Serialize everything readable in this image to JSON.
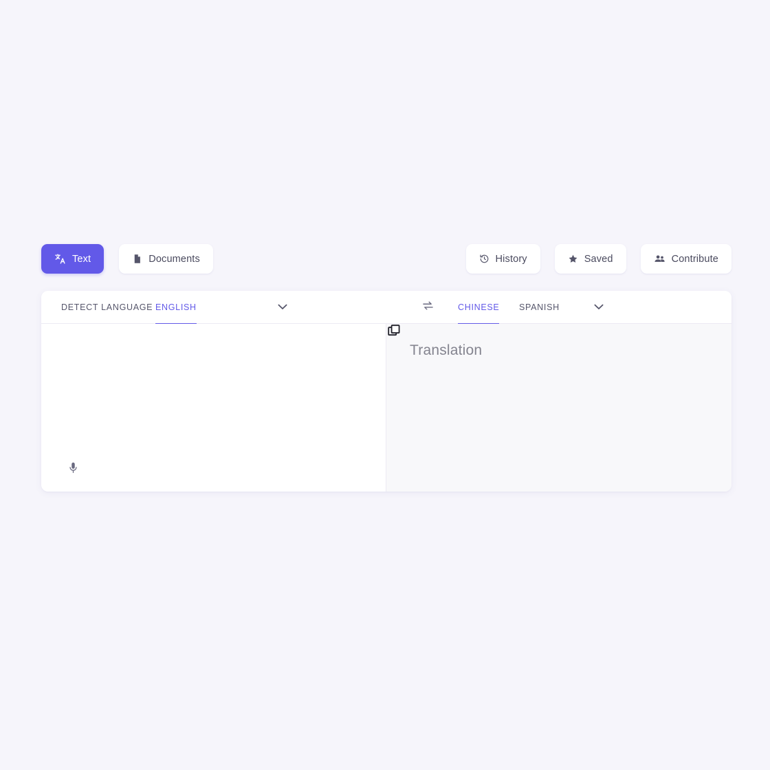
{
  "theme": {
    "accent": "#6259e8",
    "page_bg": "#f6f5fb",
    "card_bg": "#ffffff",
    "output_bg": "#f8f8fa",
    "text_muted": "#84848f"
  },
  "toolbar": {
    "left_items": [
      {
        "label": "Text",
        "icon": "translate-icon",
        "active": true
      },
      {
        "label": "Documents",
        "icon": "document-icon",
        "active": false
      }
    ],
    "right_items": [
      {
        "label": "History",
        "icon": "history-clock-icon"
      },
      {
        "label": "Saved",
        "icon": "star-icon"
      },
      {
        "label": "Contribute",
        "icon": "people-group-icon"
      }
    ]
  },
  "source_panel": {
    "tabs": [
      {
        "label": "DETECT LANGUAGE",
        "selected": false
      },
      {
        "label": "ENGLISH",
        "selected": true
      }
    ],
    "dropdown_icon": "chevron-down-icon",
    "input_value": "",
    "input_placeholder": "",
    "mic_icon": "microphone-icon"
  },
  "swap": {
    "icon": "swap-arrows-icon"
  },
  "target_panel": {
    "tabs": [
      {
        "label": "CHINESE",
        "selected": true
      },
      {
        "label": "SPANISH",
        "selected": false
      }
    ],
    "dropdown_icon": "chevron-down-icon",
    "output_text": "Translation",
    "copy_icon": "copy-icon"
  }
}
